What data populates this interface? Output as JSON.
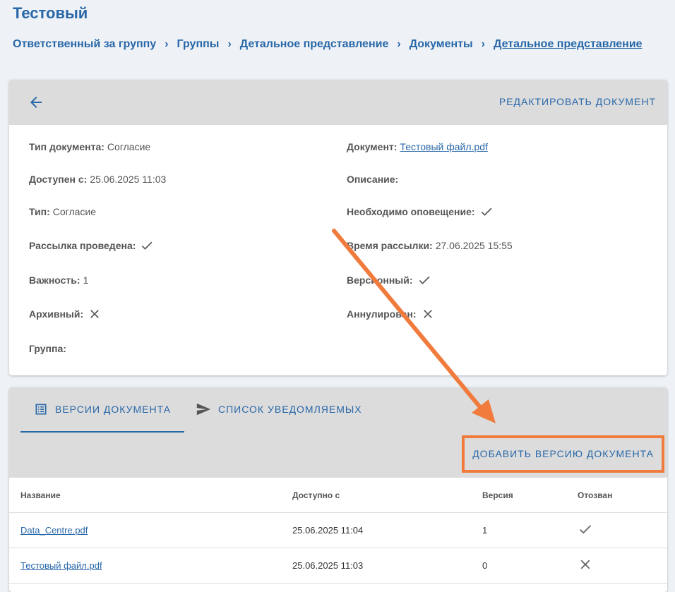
{
  "page": {
    "title": "Тестовый"
  },
  "breadcrumb": [
    "Ответственный за группу",
    "Группы",
    "Детальное представление",
    "Документы",
    "Детальное представление"
  ],
  "document_card": {
    "edit_label": "РЕДАКТИРОВАТЬ ДОКУМЕНТ",
    "doc_type_label": "Тип документа:",
    "doc_type_value": "Согласие",
    "available_label": "Доступен с:",
    "available_value": "25.06.2025 11:03",
    "type_label": "Тип:",
    "type_value": "Согласие",
    "mailing_done_label": "Рассылка проведена:",
    "importance_label": "Важность:",
    "importance_value": "1",
    "archived_label": "Архивный:",
    "group_label": "Группа:",
    "document_label": "Документ:",
    "document_value": "Тестовый файл.pdf",
    "description_label": "Описание:",
    "notify_label": "Необходимо оповещение:",
    "mailing_time_label": "Время рассылки:",
    "mailing_time_value": "27.06.2025 15:55",
    "versioned_label": "Версионный:",
    "annulled_label": "Аннулирован:"
  },
  "tabs": {
    "versions": "ВЕРСИИ ДОКУМЕНТА",
    "recipients": "СПИСОК УВЕДОМЛЯЕМЫХ"
  },
  "add_version_label": "ДОБАВИТЬ ВЕРСИЮ ДОКУМЕНТА",
  "table": {
    "headers": [
      "Название",
      "Доступно с",
      "Версия",
      "Отозван"
    ],
    "rows": [
      {
        "name": "Data_Centre.pdf",
        "available": "25.06.2025 11:04",
        "version": "1",
        "revoked": "check-icon"
      },
      {
        "name": "Тестовый файл.pdf",
        "available": "25.06.2025 11:03",
        "version": "0",
        "revoked": "close-icon"
      }
    ]
  },
  "colors": {
    "accent": "#2867a8",
    "highlight": "#f07b3c",
    "header_bg": "#dcdcdc"
  }
}
